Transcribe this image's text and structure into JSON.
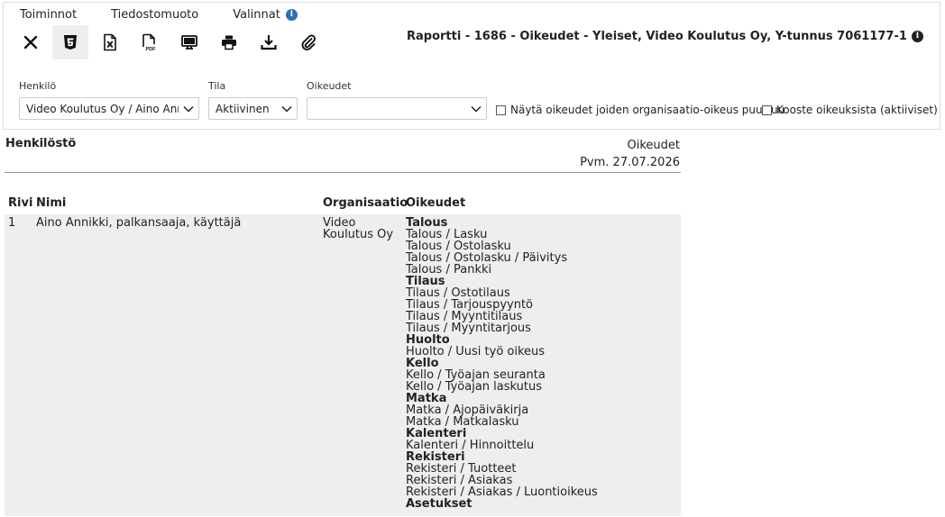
{
  "menu": {
    "toiminnot": "Toiminnot",
    "tiedostomuoto": "Tiedostomuoto",
    "valinnat": "Valinnat",
    "valinnat_info_icon": "i"
  },
  "toolbar": {
    "icons": [
      "close-icon",
      "html5-icon",
      "excel-file-icon",
      "pdf-file-icon",
      "monitor-icon",
      "printer-icon",
      "download-icon",
      "paperclip-icon"
    ]
  },
  "report": {
    "title": "Raportti - 1686 - Oikeudet - Yleiset, Video Koulutus Oy, Y-tunnus 7061177-1",
    "info_icon": "i"
  },
  "filters": {
    "henkilo_label": "Henkilö",
    "henkilo_value": "Video Koulutus Oy / Aino Annikki",
    "tila_label": "Tila",
    "tila_value": "Aktiivinen",
    "oikeudet_label": "Oikeudet",
    "oikeudet_value": "",
    "check_missing_org": "Näytä oikeudet joiden organisaatio-oikeus puuttuu",
    "check_missing_org_checked": false,
    "check_summary": "Kooste oikeuksista (aktiiviset)",
    "check_summary_checked": false
  },
  "section": {
    "title": "Henkilöstö",
    "right_title": "Oikeudet",
    "date": "Pvm. 27.07.2026"
  },
  "table": {
    "headers": {
      "rivi": "Rivi",
      "nimi": "Nimi",
      "organisaatio": "Organisaatio",
      "oikeudet": "Oikeudet"
    },
    "rows": [
      {
        "rivi": "1",
        "nimi": "Aino Annikki, palkansaaja, käyttäjä",
        "organisaatio_line1": "Video",
        "organisaatio_line2": "Koulutus Oy",
        "oikeudet": [
          {
            "text": "Talous",
            "group": true
          },
          {
            "text": "Talous / Lasku",
            "group": false
          },
          {
            "text": "Talous / Ostolasku",
            "group": false
          },
          {
            "text": "Talous / Ostolasku / Päivitys",
            "group": false
          },
          {
            "text": "Talous / Pankki",
            "group": false
          },
          {
            "text": "Tilaus",
            "group": true
          },
          {
            "text": "Tilaus / Ostotilaus",
            "group": false
          },
          {
            "text": "Tilaus / Tarjouspyyntö",
            "group": false
          },
          {
            "text": "Tilaus / Myyntitilaus",
            "group": false
          },
          {
            "text": "Tilaus / Myyntitarjous",
            "group": false
          },
          {
            "text": "Huolto",
            "group": true
          },
          {
            "text": "Huolto / Uusi työ oikeus",
            "group": false
          },
          {
            "text": "Kello",
            "group": true
          },
          {
            "text": "Kello / Työajan seuranta",
            "group": false
          },
          {
            "text": "Kello / Työajan laskutus",
            "group": false
          },
          {
            "text": "Matka",
            "group": true
          },
          {
            "text": "Matka / Ajopäiväkirja",
            "group": false
          },
          {
            "text": "Matka / Matkalasku",
            "group": false
          },
          {
            "text": "Kalenteri",
            "group": true
          },
          {
            "text": "Kalenteri / Hinnoittelu",
            "group": false
          },
          {
            "text": "Rekisteri",
            "group": true
          },
          {
            "text": "Rekisteri / Tuotteet",
            "group": false
          },
          {
            "text": "Rekisteri / Asiakas",
            "group": false
          },
          {
            "text": "Rekisteri / Asiakas / Luontioikeus",
            "group": false
          },
          {
            "text": "Asetukset",
            "group": true
          }
        ]
      }
    ]
  },
  "colors": {
    "info_blue": "#2f6eba",
    "row_bg": "#eeeeee",
    "border": "#dddddd"
  }
}
